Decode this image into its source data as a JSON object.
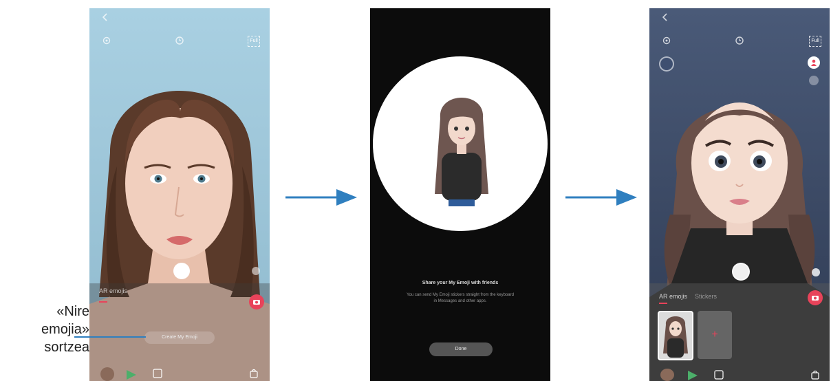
{
  "callout": {
    "line1": "«Nire",
    "line2": "emojia»",
    "line3": "sortzea"
  },
  "screen1": {
    "full_label": "Full",
    "tab_label": "AR emojis",
    "create_button_label": "Create My Emoji",
    "accent": "#e8435a"
  },
  "screen2": {
    "title": "Share your My Emoji with friends",
    "description_line1": "You can send My Emoji stickers straight from the keyboard",
    "description_line2": "in Messages and other apps.",
    "done_label": "Done"
  },
  "screen3": {
    "full_label": "Full",
    "tab_label": "AR emojis",
    "tab2_label": "Stickers",
    "add_label": "+"
  },
  "colors": {
    "arrow": "#2f7fbf",
    "screen1_bg": "#9fc7da",
    "screen2_bg": "#0c0c0c",
    "screen3_bg": "#3a4a68"
  }
}
